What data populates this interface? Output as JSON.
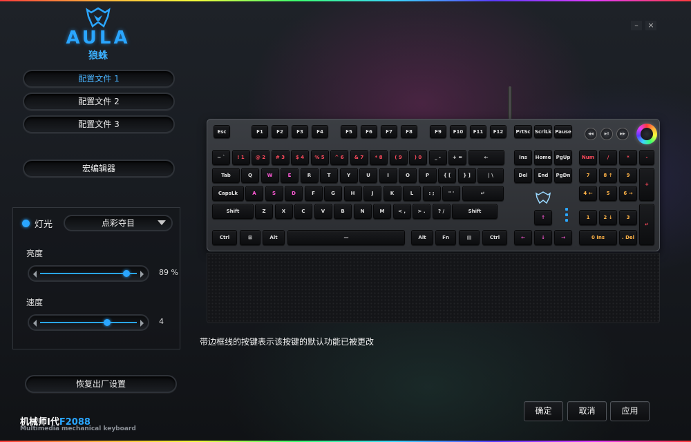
{
  "brand": {
    "logo_text": "AULA",
    "logo_sub": "狼蛛",
    "accent_color": "#2aa6ff"
  },
  "window": {
    "minimize_label": "–",
    "close_label": "×"
  },
  "profiles": [
    {
      "label": "配置文件 1",
      "active": true
    },
    {
      "label": "配置文件 2",
      "active": false
    },
    {
      "label": "配置文件 3",
      "active": false
    }
  ],
  "macro_editor_label": "宏编辑器",
  "lighting": {
    "label": "灯光",
    "mode": "点彩夺目",
    "brightness_label": "亮度",
    "brightness_value": 89,
    "brightness_text": "89 %",
    "speed_label": "速度",
    "speed_value": 4,
    "speed_text": "4",
    "speed_fraction": 0.69
  },
  "factory_reset_label": "恢复出厂设置",
  "product": {
    "name_prefix": "机械师I代",
    "model": "F2088",
    "description": "Multimedia mechanical keyboard"
  },
  "keyboard": {
    "function_row": [
      "Esc",
      "F1",
      "F2",
      "F3",
      "F4",
      "F5",
      "F6",
      "F7",
      "F8",
      "F9",
      "F10",
      "F11",
      "F12",
      "PrtSc",
      "ScrlLk",
      "Pause"
    ],
    "number_row": [
      "~ `",
      "! 1",
      "@ 2",
      "# 3",
      "$ 4",
      "% 5",
      "^ 6",
      "& 7",
      "* 8",
      "( 9",
      ") 0",
      "_ -",
      "+ =",
      "←"
    ],
    "qwerty_row": [
      "Tab",
      "Q",
      "W",
      "E",
      "R",
      "T",
      "Y",
      "U",
      "I",
      "O",
      "P",
      "{ [",
      "} ]",
      "| \\"
    ],
    "home_row": [
      "CapsLk",
      "A",
      "S",
      "D",
      "F",
      "G",
      "H",
      "J",
      "K",
      "L",
      ": ;",
      "\" '",
      "↵"
    ],
    "shift_row": [
      "Shift",
      "Z",
      "X",
      "C",
      "V",
      "B",
      "N",
      "M",
      "< ,",
      "> .",
      "? /",
      "Shift"
    ],
    "bottom_row": [
      "Ctrl",
      "⊞",
      "Alt",
      "",
      "Alt",
      "Fn",
      "▤",
      "Ctrl"
    ],
    "nav_top": [
      "Ins",
      "Home",
      "PgUp",
      "Del",
      "End",
      "PgDn"
    ],
    "arrows": [
      "↑",
      "←",
      "↓",
      "→"
    ],
    "numpad": [
      "Num",
      "/",
      "*",
      "-",
      "7",
      "8 ↑",
      "9",
      "+",
      "4 ←",
      "5",
      "6 →",
      "1",
      "2 ↓",
      "3",
      "↵",
      "0 Ins",
      ". Del"
    ],
    "media_buttons": [
      "◀◀",
      "▶II",
      "▶▶"
    ]
  },
  "hint_text": "带边框线的按键表示该按键的默认功能已被更改",
  "actions": {
    "ok": "确定",
    "cancel": "取消",
    "apply": "应用"
  }
}
